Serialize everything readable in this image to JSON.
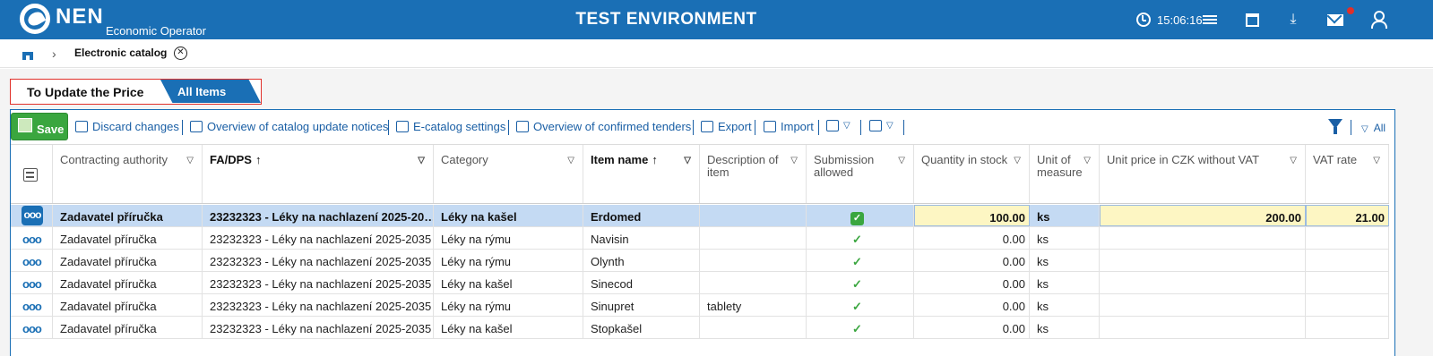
{
  "header": {
    "logo": "NEN",
    "subtitle": "Economic Operator",
    "environment": "TEST ENVIRONMENT",
    "time": "15:06:16"
  },
  "breadcrumb": {
    "label": "Electronic catalog"
  },
  "tabs": {
    "price": "To Update the Price",
    "all": "All Items"
  },
  "toolbar": {
    "save": "Save",
    "discard": "Discard changes",
    "overview_notices": "Overview of catalog update notices",
    "settings": "E-catalog settings",
    "overview_tenders": "Overview of confirmed tenders",
    "export": "Export",
    "import": "Import",
    "filter_all": "All"
  },
  "columns": {
    "authority": "Contracting authority",
    "fadps": "FA/DPS",
    "category": "Category",
    "item_name": "Item name",
    "description": "Description of item",
    "submission": "Submission allowed",
    "quantity": "Quantity in stock",
    "unit": "Unit of measure",
    "price": "Unit price in CZK without VAT",
    "vat": "VAT rate"
  },
  "rows": [
    {
      "authority": "Zadavatel příručka",
      "fadps": "23232323 - Léky na nachlazení 2025-20…",
      "category": "Léky na kašel",
      "name": "Erdomed",
      "desc": "",
      "qty": "100.00",
      "unit": "ks",
      "price": "200.00",
      "vat": "21.00"
    },
    {
      "authority": "Zadavatel příručka",
      "fadps": "23232323 - Léky na nachlazení 2025-2035",
      "category": "Léky na rýmu",
      "name": "Navisin",
      "desc": "",
      "qty": "0.00",
      "unit": "ks",
      "price": "",
      "vat": ""
    },
    {
      "authority": "Zadavatel příručka",
      "fadps": "23232323 - Léky na nachlazení 2025-2035",
      "category": "Léky na rýmu",
      "name": "Olynth",
      "desc": "",
      "qty": "0.00",
      "unit": "ks",
      "price": "",
      "vat": ""
    },
    {
      "authority": "Zadavatel příručka",
      "fadps": "23232323 - Léky na nachlazení 2025-2035",
      "category": "Léky na kašel",
      "name": "Sinecod",
      "desc": "",
      "qty": "0.00",
      "unit": "ks",
      "price": "",
      "vat": ""
    },
    {
      "authority": "Zadavatel příručka",
      "fadps": "23232323 - Léky na nachlazení 2025-2035",
      "category": "Léky na rýmu",
      "name": "Sinupret",
      "desc": "tablety",
      "qty": "0.00",
      "unit": "ks",
      "price": "",
      "vat": ""
    },
    {
      "authority": "Zadavatel příručka",
      "fadps": "23232323 - Léky na nachlazení 2025-2035",
      "category": "Léky na kašel",
      "name": "Stopkašel",
      "desc": "",
      "qty": "0.00",
      "unit": "ks",
      "price": "",
      "vat": ""
    }
  ]
}
